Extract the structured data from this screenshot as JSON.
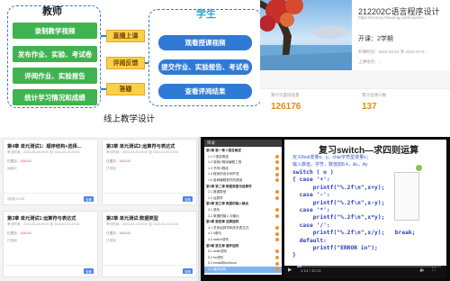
{
  "q1": {
    "teacher_title": "教师",
    "teacher_items": [
      "录制教学视频",
      "发布作业、实验、考试卷",
      "评阅作业、实验报告",
      "统计学习情况和成绩"
    ],
    "middle_items": [
      "直播上课",
      "评阅反馈",
      "答疑"
    ],
    "student_title": "学生",
    "student_items": [
      "观看授课视频",
      "提交作业、实验报告、考试卷",
      "查看评阅结果"
    ],
    "caption": "线上教学设计",
    "colors": {
      "green": "#3fb34f",
      "blue": "#2f7ad4",
      "yellow": "#f7d14a"
    }
  },
  "q2": {
    "course_title": "212202C语言程序设计",
    "course_link": "https://mooc1.chaoxing.com/course/...",
    "semester": "开课：2学期",
    "date_line": "开课时间：2022-03-01 到 2022-07-0...",
    "location_line": "上课地点：...",
    "stats": [
      {
        "label": "累计页面浏览量",
        "value": "126176"
      },
      {
        "label": "累计选课人数",
        "value": "137"
      }
    ],
    "accent": "#e28a16"
  },
  "q3": {
    "cards": [
      {
        "title": "第4章 单元测试1：顺序结构+选择...",
        "time": "考试时间：2022-05-28 09:00 至 2022-04-23 22:00",
        "submitted_label": "已提交：",
        "submitted": "135",
        "total": "141",
        "status_label": "阅卷中",
        "pct": "0",
        "pct_label": "批阅 0/135",
        "button": "查看"
      },
      {
        "title": "第3章 单元测试2:运算符与表达式",
        "time": "考试时间：2022-03-20 09:00 至 2022-03-20 22:00",
        "submitted_label": "已提交：",
        "submitted": "144",
        "total": "141",
        "status_label": "已批阅",
        "pct": "",
        "pct_label": "",
        "button": "查看"
      },
      {
        "title": "第3章 单元测试1:运算符与表达式",
        "time": "考试时间：2022-03-28 09:00 至 2022-03-20 22:00",
        "submitted_label": "已提交：",
        "submitted": "144",
        "total": "141",
        "status_label": "已批阅",
        "pct": "",
        "pct_label": "",
        "button": "查看"
      },
      {
        "title": "第2章 单元测试:数据类型",
        "time": "考试时间：2022-03-13 09:00 至 2022-03-13 21:00",
        "submitted_label": "已提交：",
        "submitted": "144",
        "total": "141",
        "status_label": "已批阅",
        "pct": "",
        "pct_label": "",
        "button": "查看"
      }
    ]
  },
  "q4": {
    "panel_title": "目录",
    "toc": [
      {
        "text": "第1章 第一章 C语言概述",
        "sec": true,
        "act": false
      },
      {
        "text": "1.1 C语言概述",
        "sec": false,
        "act": false
      },
      {
        "text": "1.2 使用C程序编程工具",
        "sec": false,
        "act": false
      },
      {
        "text": "1.3 书写C程序",
        "sec": false,
        "act": false
      },
      {
        "text": "1.4 程序的设计和开发",
        "sec": false,
        "act": false
      },
      {
        "text": "1.5 各种编程软件的使用",
        "sec": false,
        "act": false
      },
      {
        "text": "第2章 第二章 数据类型与运算符",
        "sec": true,
        "act": false
      },
      {
        "text": "2.1 数据类型",
        "sec": false,
        "act": false
      },
      {
        "text": "2.2 运算符",
        "sec": false,
        "act": false
      },
      {
        "text": "第3章 第三章 数据的输入输出",
        "sec": true,
        "act": false
      },
      {
        "text": "3.1 语句",
        "sec": false,
        "act": false
      },
      {
        "text": "3.2 数据的输入与输出",
        "sec": false,
        "act": false
      },
      {
        "text": "第4章 第四章 选择结构",
        "sec": true,
        "act": false
      },
      {
        "text": "4.1 关系运算符和关系表达式",
        "sec": false,
        "act": false
      },
      {
        "text": "4.2 if语句",
        "sec": false,
        "act": false
      },
      {
        "text": "4.3 switch语句",
        "sec": false,
        "act": false
      },
      {
        "text": "第5章 第五章 循环结构",
        "sec": true,
        "act": false
      },
      {
        "text": "5.1 while语句",
        "sec": false,
        "act": false
      },
      {
        "text": "5.2 for语句",
        "sec": false,
        "act": false
      },
      {
        "text": "5.3 break和continue",
        "sec": false,
        "act": false
      },
      {
        "text": "4.2 循环结构",
        "sec": false,
        "act": true
      }
    ],
    "slide_title": "复习switch—求四则运算",
    "slide_sub": "定义float变量x、y，char字符型变量o；",
    "slide_sub2": "输入数值，字符，数值如8.4，&c，Ay",
    "code_lines": [
      "switch ( o )",
      "{ case '+':",
      "      printf(\"%.2f\\n\",x+y);   break;",
      "  case '-':",
      "      printf(\"%.2f\\n\",x-y);   break;",
      "  case '*':",
      "      printf(\"%.2f\\n\",x*y);   break;",
      "  case '/':",
      "      printf(\"%.2f\\n\",x/y);   break;",
      "  default:",
      "      printf(\"ERROR in\");",
      "}"
    ],
    "time_text": "1:14 / 42:14",
    "progress": 0.03
  }
}
